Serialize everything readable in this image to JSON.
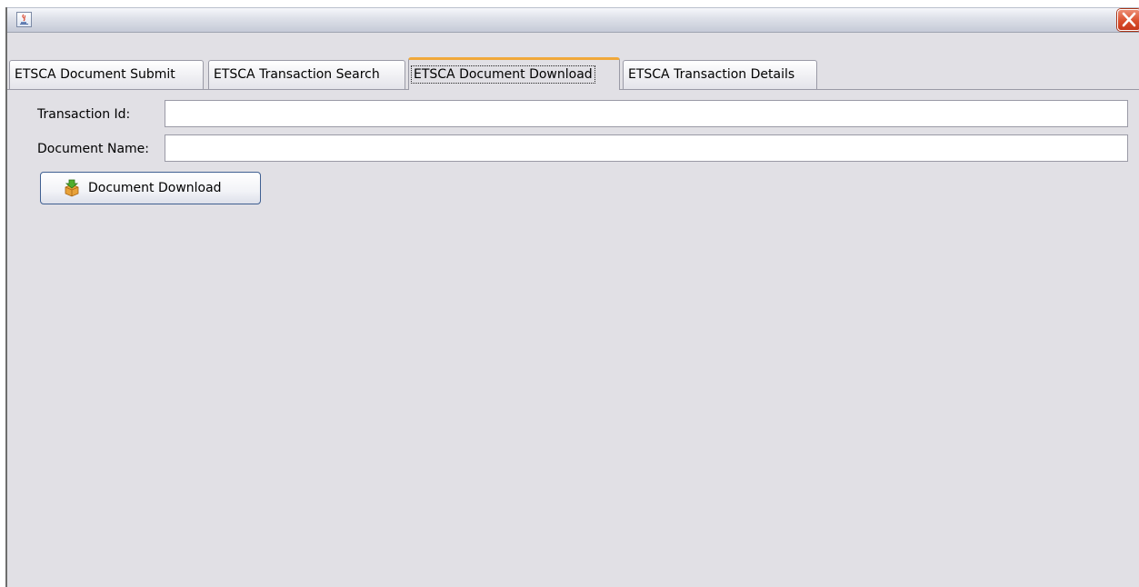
{
  "window": {
    "icons": {
      "app": "java-cup-icon",
      "close": "close-x-icon"
    }
  },
  "tabs": [
    {
      "label": "ETSCA Document Submit",
      "active": false
    },
    {
      "label": "ETSCA Transaction Search",
      "active": false
    },
    {
      "label": "ETSCA Document Download",
      "active": true
    },
    {
      "label": "ETSCA Transaction Details",
      "active": false
    }
  ],
  "form": {
    "transaction_id_label": "Transaction Id:",
    "transaction_id_value": "",
    "document_name_label": "Document Name:",
    "document_name_value": ""
  },
  "download_button": {
    "label": "Document Download",
    "icon": "download-box-icon"
  },
  "colors": {
    "active_tab_accent": "#f0a83a",
    "close_button": "#da4f2c",
    "panel_background": "#e1e0e5"
  }
}
